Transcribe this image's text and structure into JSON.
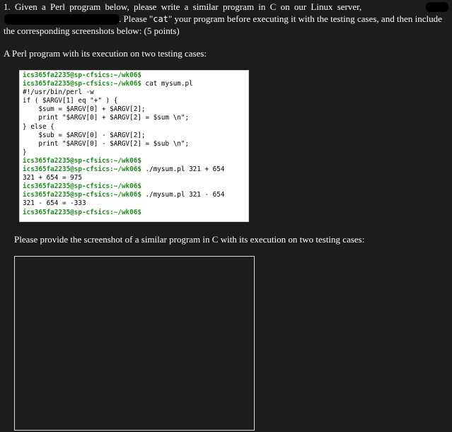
{
  "question": {
    "line1": "1. Given a Perl program below, please write a similar program in C on our Linux server,",
    "line2_prefix": ". Please \"",
    "line2_code": "cat",
    "line2_suffix": "\" your program before executing it with the testing cases, and then include",
    "line3": "the corresponding screenshots below: (5 points)"
  },
  "subheading": "A Perl program with its execution on two testing cases:",
  "terminal": {
    "lines": [
      {
        "prompt": "ics365fa2235@sp-cfsics:~/wk06$",
        "cmd": ""
      },
      {
        "prompt": "ics365fa2235@sp-cfsics:~/wk06$",
        "cmd": " cat mysum.pl"
      },
      {
        "text": "#!/usr/bin/perl -w"
      },
      {
        "text": "if ( $ARGV[1] eq \"+\" ) {"
      },
      {
        "text": "    $sum = $ARGV[0] + $ARGV[2];"
      },
      {
        "text": "    print \"$ARGV[0] + $ARGV[2] = $sum \\n\";"
      },
      {
        "text": "} else {"
      },
      {
        "text": "    $sub = $ARGV[0] - $ARGV[2];"
      },
      {
        "text": "    print \"$ARGV[0] - $ARGV[2] = $sub \\n\";"
      },
      {
        "text": "}"
      },
      {
        "prompt": "ics365fa2235@sp-cfsics:~/wk06$",
        "cmd": ""
      },
      {
        "prompt": "ics365fa2235@sp-cfsics:~/wk06$",
        "cmd": " ./mysum.pl 321 + 654"
      },
      {
        "text": "321 + 654 = 975"
      },
      {
        "prompt": "ics365fa2235@sp-cfsics:~/wk06$",
        "cmd": ""
      },
      {
        "prompt": "ics365fa2235@sp-cfsics:~/wk06$",
        "cmd": " ./mysum.pl 321 - 654"
      },
      {
        "text": "321 - 654 = -333"
      },
      {
        "prompt": "ics365fa2235@sp-cfsics:~/wk06$",
        "cmd": ""
      }
    ]
  },
  "instruction": "Please provide the screenshot of a similar program in C with its execution on two testing cases:",
  "colors": {
    "background": "#1c1c1c",
    "text": "#ffffff",
    "prompt_green": "#1f8a1f",
    "terminal_bg": "#ffffff"
  }
}
